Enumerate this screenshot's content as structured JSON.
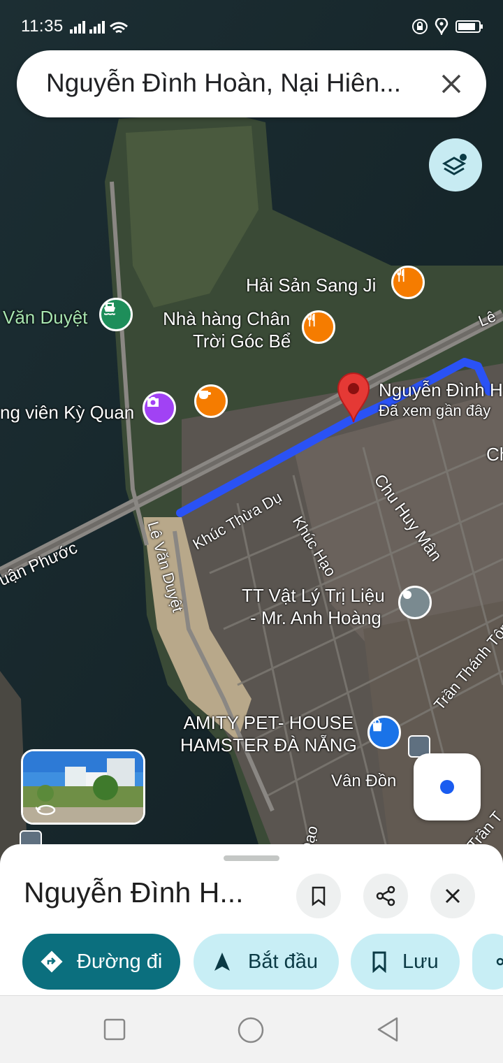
{
  "status": {
    "time": "11:35"
  },
  "search": {
    "query": "Nguyễn Đình Hoàn, Nại Hiên..."
  },
  "map": {
    "pois": [
      {
        "name": "Hải Sản Sang Ji",
        "icon": "restaurant-icon"
      },
      {
        "name_line1": "Nhà hàng Chân",
        "name_line2": "Trời Góc Bể",
        "icon": "restaurant-icon"
      },
      {
        "name": "Văn Duyệt",
        "icon": "ferry-icon"
      },
      {
        "name": "ng viên Kỳ Quan",
        "icon": "camera-icon"
      },
      {
        "name": "",
        "icon": "cafe-icon"
      },
      {
        "name_line1": "Nguyễn Đình H",
        "name_line2": "Đã xem gần đây",
        "icon": "red-pin-icon"
      },
      {
        "name": "Ch",
        "icon": ""
      },
      {
        "name_line1": "TT Vật Lý Trị Liệu",
        "name_line2": "- Mr. Anh Hoàng",
        "icon": "place-icon"
      },
      {
        "name_line1": "AMITY PET- HOUSE",
        "name_line2": "HAMSTER ĐÀ NẴNG",
        "icon": "shopping-bag-icon"
      }
    ],
    "streets": [
      "Lê",
      "Chu Huy Mân",
      "Khúc Thừa Dụ",
      "Khúc Hạo",
      "Lê Văn Duyệt",
      "uận Phước",
      "Trần Thánh Tôn",
      "Vân Đồn",
      "g Đạo",
      "Trần T"
    ],
    "colors": {
      "route": "#2a52f5",
      "pin": "#e53935",
      "restaurant": "#f57c00",
      "ferry": "#1e8e5a",
      "camera": "#a142f4",
      "shop": "#1a73e8",
      "teal": "#0b6f7e"
    }
  },
  "sheet": {
    "title": "Nguyễn Đình H...",
    "actions": [
      {
        "label": "Đường đi",
        "icon": "directions-icon"
      },
      {
        "label": "Bắt đầu",
        "icon": "navigation-arrow-icon"
      },
      {
        "label": "Lưu",
        "icon": "bookmark-icon"
      }
    ]
  }
}
